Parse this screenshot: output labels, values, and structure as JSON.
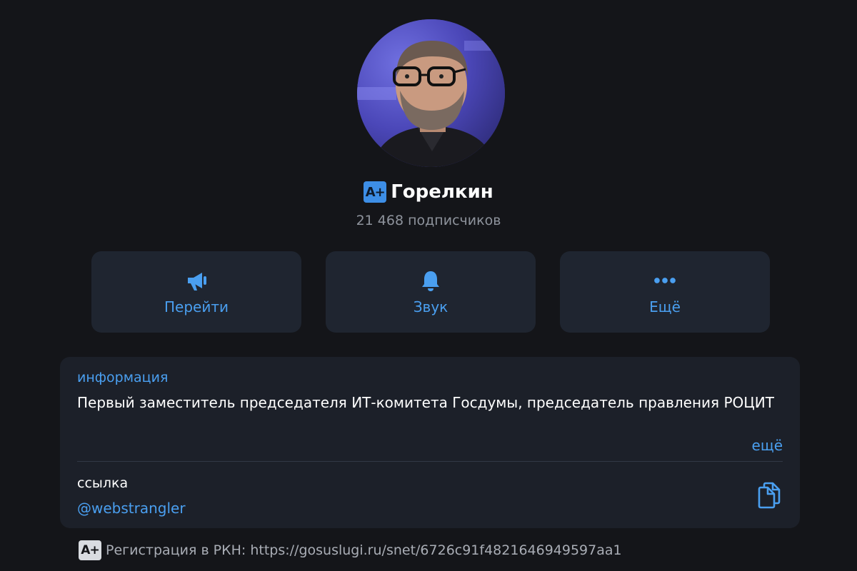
{
  "profile": {
    "name": "Горелкин",
    "badge": "A+",
    "subscribers": "21 468 подписчиков"
  },
  "actions": [
    {
      "label": "Перейти",
      "icon": "megaphone-icon"
    },
    {
      "label": "Звук",
      "icon": "bell-icon"
    },
    {
      "label": "Ещё",
      "icon": "more-dots-icon"
    }
  ],
  "info": {
    "title": "информация",
    "text": "Первый заместитель председателя ИТ-комитета Госдумы, председатель правления РОЦИТ",
    "more": "ещё",
    "link_label": "ссылка",
    "link_value": "@webstrangler",
    "copy_icon": "copy-icon"
  },
  "registration": {
    "badge": "A+",
    "text": "Регистрация в РКН: https://gosuslugi.ru/snet/6726c91f4821646949597aa1"
  },
  "colors": {
    "background": "#141519",
    "card": "#1c2029",
    "button": "#1f2530",
    "accent": "#4a9ff0",
    "muted": "#8e939c"
  }
}
